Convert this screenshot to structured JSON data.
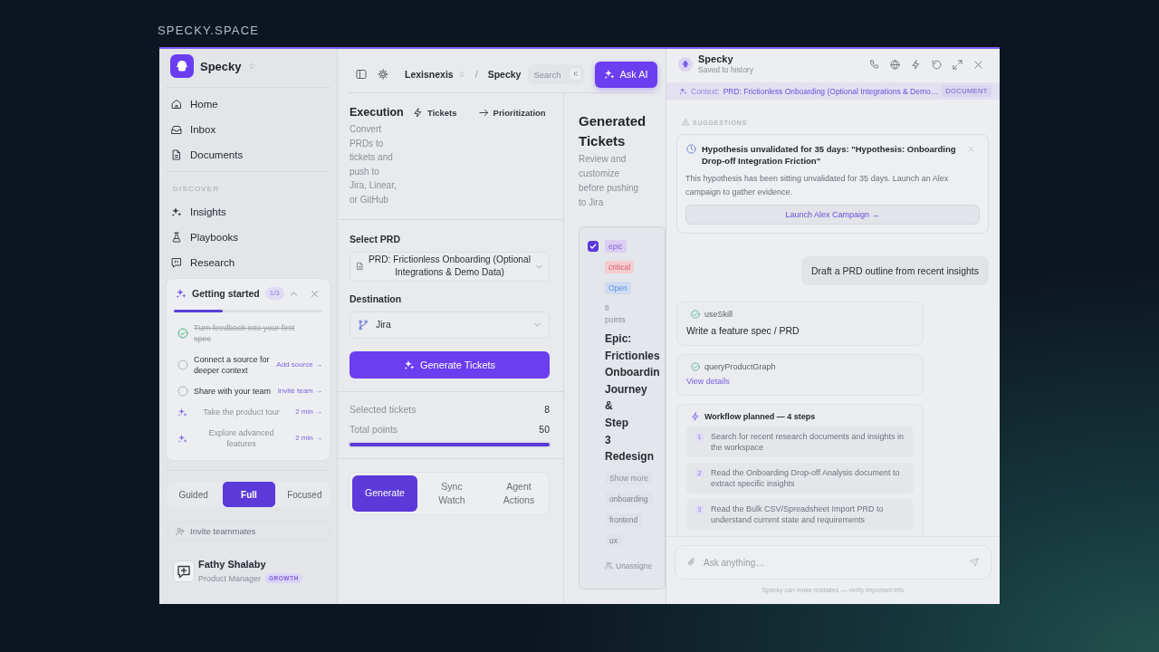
{
  "caption": "SPECKY.SPACE",
  "sidebar": {
    "workspace": "Specky",
    "nav": [
      {
        "label": "Home",
        "selected": false
      },
      {
        "label": "Inbox",
        "selected": false
      },
      {
        "label": "Documents",
        "selected": false
      }
    ],
    "section_title": "DISCOVER",
    "discover": [
      {
        "label": "Insights",
        "selected": false
      },
      {
        "label": "Playbooks",
        "selected": false
      },
      {
        "label": "Research",
        "selected": false
      }
    ],
    "getting_started": {
      "title": "Getting started",
      "count": "1/3",
      "level": 0.33,
      "items": [
        {
          "kind": "task",
          "label": "Turn feedback into your first spec",
          "checked": true
        },
        {
          "kind": "task",
          "label": "Connect a source for deeper context",
          "checked": false,
          "action": "Add source →"
        },
        {
          "kind": "task",
          "label": "Share with your team",
          "checked": false,
          "action": "Invite team →"
        },
        {
          "kind": "tour",
          "label": "Take the product tour",
          "action": "2 min →"
        },
        {
          "kind": "tour",
          "label": "Explore advanced features",
          "action": "2 min →"
        }
      ]
    },
    "modes": [
      {
        "label": "Guided",
        "selected": false
      },
      {
        "label": "Full",
        "selected": true
      },
      {
        "label": "Focused",
        "selected": false
      }
    ],
    "invite": "Invite teammates",
    "user": {
      "name": "Fathy Shalaby",
      "role": "Product Manager",
      "badge": "GROWTH"
    }
  },
  "toolbar": {
    "breadcrumb": [
      {
        "label": "Lexisnexis"
      },
      {
        "label": "Specky"
      }
    ],
    "separator": "/",
    "search": {
      "placeholder": "Search",
      "shortcut": "K"
    },
    "ask_button": "Ask AI"
  },
  "execution": {
    "title": "Execution",
    "description": "Convert PRDs to tickets and push to Jira, Linear, or GitHub",
    "links": [
      "Tickets",
      "Prioritization"
    ],
    "prd_field": {
      "label": "Select PRD",
      "value": "PRD: Frictionless Onboarding (Optional Integrations & Demo Data)"
    },
    "destination_field": {
      "label": "Destination",
      "value": "Jira"
    },
    "generate_button": "Generate Tickets",
    "stats": [
      {
        "label": "Selected tickets",
        "value": "8"
      },
      {
        "label": "Total points",
        "value": "50"
      }
    ],
    "progress": {
      "level": 1
    },
    "tabs": [
      {
        "label": "Generate",
        "selected": true
      },
      {
        "label": "Sync Watch",
        "selected": false
      },
      {
        "label": "Agent Actions",
        "selected": false
      }
    ]
  },
  "tickets": {
    "title": "Generated Tickets",
    "description": "Review and customize before pushing to Jira",
    "items": [
      {
        "checked": true,
        "tags": [
          {
            "label": "epic",
            "color": "#dacff3"
          },
          {
            "label": "critical",
            "color": "#f3cdd1"
          },
          {
            "label": "Open",
            "color": "#cddcf3"
          }
        ],
        "points": "8 points",
        "title": "Epic: Frictionles Onboardin Journey & Step 3 Redesign",
        "more": "Show more",
        "labels": [
          "onboarding",
          "frontend",
          "ux"
        ],
        "assignee": "Unassigne"
      }
    ]
  },
  "chat": {
    "title": "Specky",
    "subtitle": "Saved to history",
    "context": {
      "label": "Context:",
      "value": "PRD: Frictionless Onboarding (Optional Integrations & Demo…",
      "badge": "DOCUMENT"
    },
    "suggestions_title": "SUGGESTIONS",
    "suggestion": {
      "title": "Hypothesis unvalidated for 35 days: \"Hypothesis: Onboarding Drop-off Integration Friction\"",
      "body": "This hypothesis has been sitting unvalidated for 35 days. Launch an Alex campaign to gather evidence.",
      "action": "Launch Alex Campaign →"
    },
    "messages": [
      {
        "kind": "user",
        "text": "Draft a PRD outline from recent insights"
      },
      {
        "kind": "tool",
        "tool": "useSkill",
        "text": "Write a feature spec / PRD"
      },
      {
        "kind": "tool",
        "tool": "queryProductGraph",
        "link": "View details"
      },
      {
        "kind": "workflow",
        "title": "Workflow planned — 4 steps",
        "steps": [
          {
            "number": "1",
            "text": "Search for recent research documents and insights in the workspace"
          },
          {
            "number": "2",
            "text": "Read the Onboarding Drop-off Analysis document to extract specific insights"
          },
          {
            "number": "3",
            "text": "Read the Bulk CSV/Spreadsheet Import PRD to understand current state and requirements"
          }
        ]
      }
    ],
    "input": {
      "placeholder": "Ask anything…"
    },
    "disclaimer": "Specky can make mistakes — verify important info"
  }
}
